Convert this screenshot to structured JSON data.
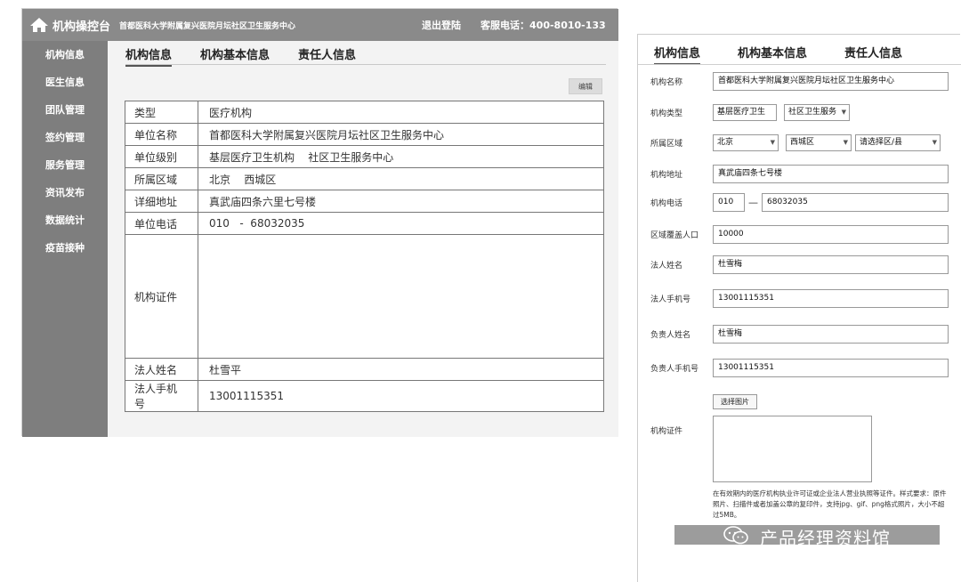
{
  "left": {
    "top_bar": {
      "brand": "机构操控台",
      "center_name": "首都医科大学附属复兴医院月坛社区卫生服务中心",
      "logout": "退出登陆",
      "hotline": "客服电话：400-8010-133"
    },
    "sidebar": {
      "items": [
        {
          "label": "机构信息"
        },
        {
          "label": "医生信息"
        },
        {
          "label": "团队管理"
        },
        {
          "label": "签约管理"
        },
        {
          "label": "服务管理"
        },
        {
          "label": "资讯发布"
        },
        {
          "label": "数据统计"
        },
        {
          "label": "疫苗接种"
        }
      ]
    },
    "tabs": [
      {
        "label": "机构信息"
      },
      {
        "label": "机构基本信息"
      },
      {
        "label": "责任人信息"
      }
    ],
    "edit_label": "编辑",
    "table": {
      "type": {
        "label": "类型",
        "value": "医疗机构"
      },
      "unit_name": {
        "label": "单位名称",
        "value": "首都医科大学附属复兴医院月坛社区卫生服务中心"
      },
      "unit_level": {
        "label": "单位级别",
        "value": "基层医疗卫生机构    社区卫生服务中心"
      },
      "region": {
        "label": "所属区域",
        "value": "北京    西城区"
      },
      "address": {
        "label": "详细地址",
        "value": "真武庙四条六里七号楼"
      },
      "phone": {
        "label": "单位电话",
        "value": "010   -  68032035"
      },
      "certificate": {
        "label": "机构证件",
        "value": ""
      },
      "legal_name": {
        "label": "法人姓名",
        "value": "杜雪平"
      },
      "legal_phone": {
        "label": "法人手机号",
        "value": "13001115351"
      }
    }
  },
  "right": {
    "tabs": [
      {
        "label": "机构信息"
      },
      {
        "label": "机构基本信息"
      },
      {
        "label": "责任人信息"
      }
    ],
    "form": {
      "name": {
        "label": "机构名称",
        "value": "首都医科大学附属复兴医院月坛社区卫生服务中心"
      },
      "type": {
        "label": "机构类型",
        "select1": "基层医疗卫生",
        "select2": "社区卫生服务"
      },
      "region": {
        "label": "所属区域",
        "province": "北京",
        "district": "西城区",
        "county_placeholder": "请选择区/县"
      },
      "address": {
        "label": "机构地址",
        "value": "真武庙四条七号楼"
      },
      "phone": {
        "label": "机构电话",
        "area": "010",
        "dash": "—",
        "number": "68032035"
      },
      "population": {
        "label": "区域覆盖人口",
        "value": "10000"
      },
      "legal_name": {
        "label": "法人姓名",
        "value": "杜雪梅"
      },
      "legal_phone": {
        "label": "法人手机号",
        "value": "13001115351"
      },
      "owner_name": {
        "label": "负责人姓名",
        "value": "杜雪梅"
      },
      "owner_phone": {
        "label": "负责人手机号",
        "value": "13001115351"
      },
      "upload_label": "选择图片",
      "certificate_label": "机构证件",
      "certificate_note": "在有效期内的医疗机构执业许可证或企业法人营业执照等证件。样式要求：原件照片、扫描件或者加盖公章的复印件，支持jpg、gif、png格式照片，大小不超过5MB。"
    },
    "watermark": "产品经理资料馆"
  },
  "colors": {
    "top_bar": "#8a8a8a",
    "sidebar": "#7e7e7e",
    "panel_bg": "#f3f3f3"
  }
}
